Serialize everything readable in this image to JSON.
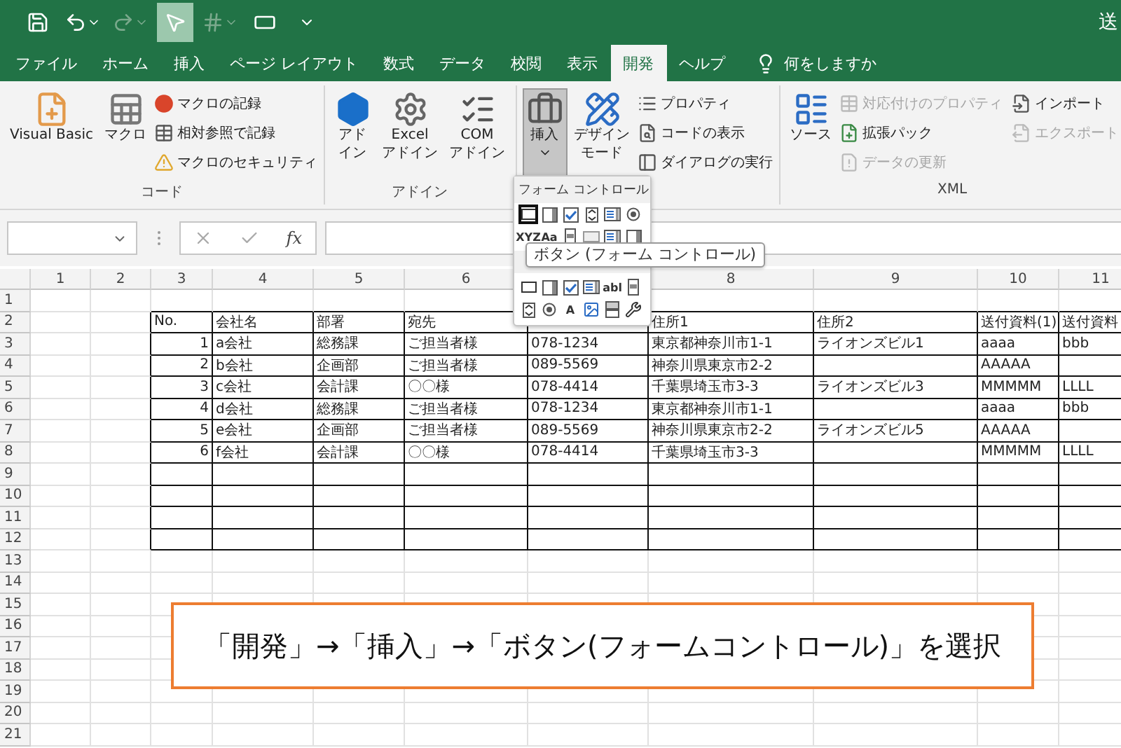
{
  "title_bar": {
    "title": "送",
    "quick_access": [
      {
        "kind": "save",
        "disabled": false,
        "selected": false
      },
      {
        "kind": "undo",
        "disabled": false,
        "selected": false
      },
      {
        "kind": "redo",
        "disabled": true,
        "selected": false
      },
      {
        "kind": "pointer",
        "disabled": false,
        "selected": true
      },
      {
        "kind": "grid",
        "disabled": true,
        "selected": false
      },
      {
        "kind": "shape",
        "disabled": false,
        "selected": false
      },
      {
        "kind": "customize",
        "disabled": false,
        "selected": false
      }
    ]
  },
  "tabs": [
    {
      "label": "ファイル",
      "selected": false
    },
    {
      "label": "ホーム",
      "selected": false
    },
    {
      "label": "挿入",
      "selected": false
    },
    {
      "label": "ページ レイアウト",
      "selected": false
    },
    {
      "label": "数式",
      "selected": false
    },
    {
      "label": "データ",
      "selected": false
    },
    {
      "label": "校閲",
      "selected": false
    },
    {
      "label": "表示",
      "selected": false
    },
    {
      "label": "開発",
      "selected": true
    },
    {
      "label": "ヘルプ",
      "selected": false
    }
  ],
  "tell_me": {
    "placeholder": "何をしますか"
  },
  "ribbon": {
    "groups": [
      {
        "label": "コード",
        "large": [
          {
            "kind": "vba",
            "lines": [
              "Visual Basic"
            ],
            "pressed": false
          },
          {
            "kind": "macro",
            "lines": [
              "マクロ"
            ],
            "pressed": false
          }
        ],
        "small": [
          {
            "kind": "record",
            "label": "マクロの記録",
            "disabled": false
          },
          {
            "kind": "relative",
            "label": "相対参照で記録",
            "disabled": false
          },
          {
            "kind": "security",
            "label": "マクロのセキュリティ",
            "disabled": false
          }
        ]
      },
      {
        "label": "アドイン",
        "large": [
          {
            "kind": "addin",
            "lines": [
              "アド",
              "イン"
            ],
            "pressed": false
          },
          {
            "kind": "excel_addin",
            "lines": [
              "Excel",
              "アドイン"
            ],
            "pressed": false
          },
          {
            "kind": "com_addin",
            "lines": [
              "COM",
              "アドイン"
            ],
            "pressed": false
          }
        ]
      },
      {
        "large": [
          {
            "kind": "toolbox",
            "lines": [
              "挿入"
            ],
            "pressed": true
          },
          {
            "kind": "design",
            "lines": [
              "デザイン",
              "モード"
            ],
            "pressed": false
          }
        ],
        "small": [
          {
            "kind": "properties",
            "label": "プロパティ",
            "disabled": false
          },
          {
            "kind": "view_code",
            "label": "コードの表示",
            "disabled": false
          },
          {
            "kind": "dialog",
            "label": "ダイアログの実行",
            "disabled": false
          }
        ]
      },
      {
        "label": "XML",
        "large": [
          {
            "kind": "source",
            "lines": [
              "ソース"
            ],
            "pressed": false
          }
        ],
        "small": [
          {
            "kind": "map",
            "label": "対応付けのプロパティ",
            "disabled": true
          },
          {
            "kind": "pack",
            "label": "拡張パック",
            "disabled": false
          },
          {
            "kind": "refresh",
            "label": "データの更新",
            "disabled": true
          },
          {
            "kind": "import",
            "label": "インポート",
            "disabled": false
          },
          {
            "kind": "export",
            "label": "エクスポート",
            "disabled": true
          }
        ]
      }
    ]
  },
  "formula_bar": {
    "function_label": "fx"
  },
  "controls_menu": {
    "title": "フォーム コントロール",
    "tooltip": "ボタン (フォーム コントロール)",
    "form_controls": [
      {
        "kind": "button",
        "selected": true
      },
      {
        "kind": "combo",
        "selected": false
      },
      {
        "kind": "checkbox",
        "selected": false
      },
      {
        "kind": "spin",
        "selected": false
      },
      {
        "kind": "listbox",
        "selected": false
      },
      {
        "kind": "radio",
        "selected": false
      },
      {
        "kind": "groupbox",
        "glyph": "XYZ",
        "selected": false
      },
      {
        "kind": "label",
        "glyph": "Aa",
        "selected": false
      },
      {
        "kind": "scrollbar",
        "selected": false
      },
      {
        "kind": "field",
        "selected": false
      },
      {
        "kind": "listbox",
        "selected": false
      },
      {
        "kind": "combo",
        "selected": false
      }
    ],
    "activex_controls": [
      {
        "kind": "button",
        "selected": false
      },
      {
        "kind": "combo",
        "selected": false
      },
      {
        "kind": "checkbox",
        "selected": false
      },
      {
        "kind": "listbox",
        "selected": false
      },
      {
        "kind": "textbox",
        "glyph": "abl",
        "selected": false
      },
      {
        "kind": "scrollbar",
        "selected": false
      },
      {
        "kind": "spin",
        "selected": false
      },
      {
        "kind": "radio",
        "selected": false
      },
      {
        "kind": "label",
        "glyph": "A",
        "selected": false
      },
      {
        "kind": "image",
        "selected": false
      },
      {
        "kind": "toggle",
        "selected": false
      },
      {
        "kind": "tools",
        "selected": false
      }
    ]
  },
  "sheet": {
    "columns": [
      "1",
      "2",
      "3",
      "4",
      "5",
      "6",
      "",
      "8",
      "9",
      "10",
      "11"
    ],
    "row_numbers": [
      "1",
      "2",
      "3",
      "4",
      "5",
      "6",
      "7",
      "8",
      "9",
      "10",
      "11",
      "12",
      "13",
      "14",
      "15",
      "16",
      "17",
      "18",
      "19",
      "20",
      "21"
    ],
    "rows": [
      {
        "cells": [
          "",
          "",
          "No.",
          "会社名",
          "部署",
          "宛先",
          "",
          "住所1",
          "住所2",
          "送付資料(1)",
          "送付資料"
        ]
      },
      {
        "cells": [
          "",
          "",
          "1",
          "a会社",
          "総務課",
          "ご担当者様",
          "078-1234",
          "東京都神奈川市1-1",
          "ライオンズビル1",
          "aaaa",
          "bbb"
        ]
      },
      {
        "cells": [
          "",
          "",
          "2",
          "b会社",
          "企画部",
          "ご担当者様",
          "089-5569",
          "神奈川県東京市2-2",
          "",
          "AAAAA",
          ""
        ]
      },
      {
        "cells": [
          "",
          "",
          "3",
          "c会社",
          "会計課",
          "〇〇様",
          "078-4414",
          "千葉県埼玉市3-3",
          "ライオンズビル3",
          "MMMMM",
          "LLLL"
        ]
      },
      {
        "cells": [
          "",
          "",
          "4",
          "d会社",
          "総務課",
          "ご担当者様",
          "078-1234",
          "東京都神奈川市1-1",
          "",
          "aaaa",
          "bbb"
        ]
      },
      {
        "cells": [
          "",
          "",
          "5",
          "e会社",
          "企画部",
          "ご担当者様",
          "089-5569",
          "神奈川県東京市2-2",
          "ライオンズビル5",
          "AAAAA",
          ""
        ]
      },
      {
        "cells": [
          "",
          "",
          "6",
          "f会社",
          "会計課",
          "〇〇様",
          "078-4414",
          "千葉県埼玉市3-3",
          "",
          "MMMMM",
          "LLLL"
        ]
      }
    ]
  },
  "callout": {
    "text": "「開発」→「挿入」→「ボタン(フォームコントロール)」を選択"
  }
}
